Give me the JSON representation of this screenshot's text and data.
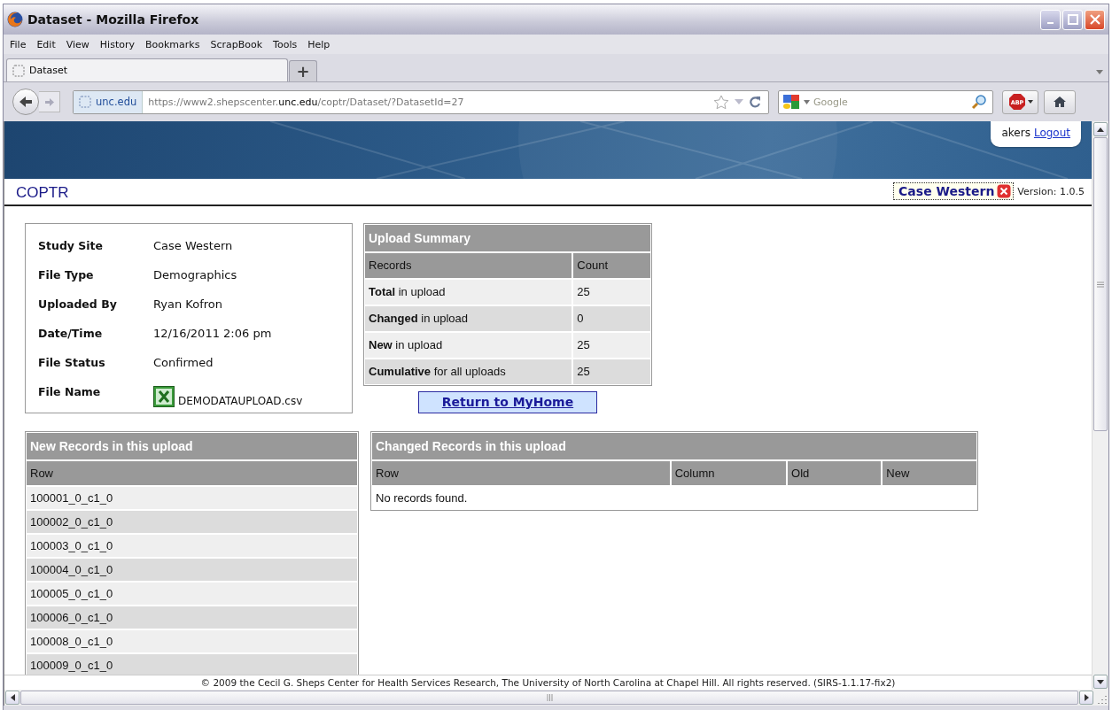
{
  "window": {
    "title": "Dataset - Mozilla Firefox"
  },
  "menu": [
    "File",
    "Edit",
    "View",
    "History",
    "Bookmarks",
    "ScrapBook",
    "Tools",
    "Help"
  ],
  "tabs": [
    {
      "label": "Dataset",
      "selected": true
    }
  ],
  "new_tab_button": "+",
  "address_bar": {
    "site_badge": "unc.edu",
    "url": "https://www2.shepscenter.**unc.edu**/coptr/Dataset/?DatasetId=27"
  },
  "search": {
    "placeholder": "Google"
  },
  "adblock_button": "ABP",
  "user": {
    "name": "akers",
    "logout": "Logout"
  },
  "app": {
    "title": "COPTR",
    "site": "Case Western",
    "version": "Version: 1.0.5"
  },
  "details": [
    {
      "label": "Study Site",
      "value": "Case Western",
      "kind": "text"
    },
    {
      "label": "File Type",
      "value": "Demographics",
      "kind": "text"
    },
    {
      "label": "Uploaded By",
      "value": "Ryan Kofron",
      "kind": "text"
    },
    {
      "label": "Date/Time",
      "value": "12/16/2011 2:06 pm",
      "kind": "text"
    },
    {
      "label": "File Status",
      "value": "Confirmed",
      "kind": "text"
    },
    {
      "label": "File Name",
      "value": "DEMODATAUPLOAD.csv",
      "kind": "file"
    }
  ],
  "upload_summary": {
    "title": "Upload Summary",
    "columns": [
      "Records",
      "Count"
    ],
    "rows": [
      {
        "records": "**Total** in upload",
        "count": "25"
      },
      {
        "records": "**Changed** in upload",
        "count": "0"
      },
      {
        "records": "**New** in upload",
        "count": "25"
      },
      {
        "records": "**Cumulative** for all uploads",
        "count": "25"
      }
    ]
  },
  "return_button": "Return to MyHome",
  "new_records": {
    "title": "New Records in this upload",
    "columns": [
      "Row"
    ],
    "rows": [
      "100001_0_c1_0",
      "100002_0_c1_0",
      "100003_0_c1_0",
      "100004_0_c1_0",
      "100005_0_c1_0",
      "100006_0_c1_0",
      "100008_0_c1_0",
      "100009_0_c1_0"
    ]
  },
  "changed_records": {
    "title": "Changed Records in this upload",
    "columns": [
      "Row",
      "Column",
      "Old",
      "New"
    ],
    "empty_message": "No records found."
  },
  "footer": "© 2009 the Cecil G. Sheps Center for Health Services Research, The University of North Carolina at Chapel Hill. All rights reserved. (SIRS-1.1.17-fix2)"
}
